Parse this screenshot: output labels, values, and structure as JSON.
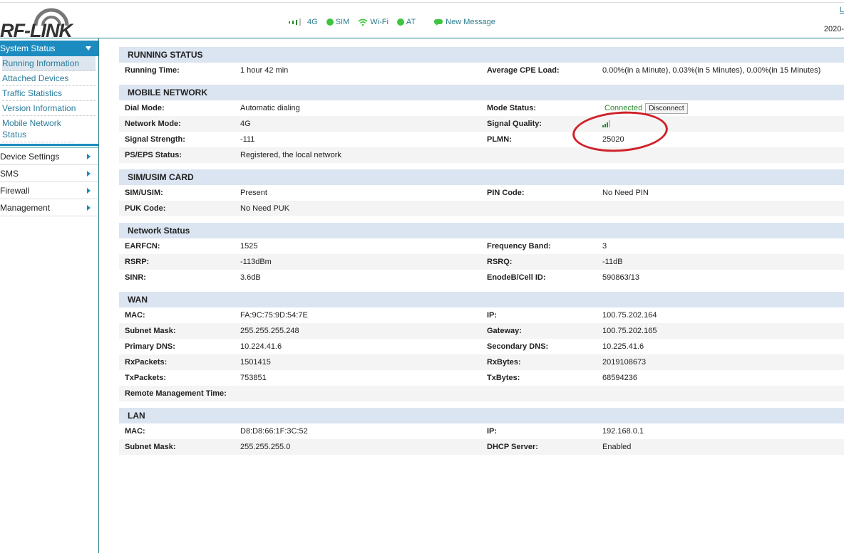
{
  "header": {
    "logo": "RF-LINK",
    "status": [
      {
        "icon": "signal-icon",
        "label": "4G"
      },
      {
        "icon": "sim-dot-icon",
        "label": "SIM"
      },
      {
        "icon": "wifi-icon",
        "label": "Wi-Fi"
      },
      {
        "icon": "at-dot-icon",
        "label": "AT"
      },
      {
        "icon": "message-icon",
        "label": "New Message"
      }
    ],
    "logout": "L",
    "date": "2020-"
  },
  "sidebar": {
    "head": "System Status",
    "sub": [
      "Running Information",
      "Attached Devices",
      "Traffic Statistics",
      "Version Information",
      "Mobile Network Status"
    ],
    "menu": [
      "Device Settings",
      "SMS",
      "Firewall",
      "Management"
    ]
  },
  "sections": [
    {
      "title": "RUNNING STATUS",
      "rows": [
        [
          "Running Time:",
          "1 hour 42 min",
          "Average CPE Load:",
          "0.00%(in a Minute), 0.03%(in 5 Minutes), 0.00%(in 15 Minutes)"
        ]
      ]
    },
    {
      "title": "MOBILE NETWORK",
      "rows": [
        [
          "Dial Mode:",
          "Automatic dialing",
          "Mode Status:",
          "Connected"
        ],
        [
          "Network Mode:",
          "4G",
          "Signal Quality:",
          ""
        ],
        [
          "Signal Strength:",
          "-111",
          "PLMN:",
          "25020"
        ],
        [
          "PS/EPS Status:",
          "Registered, the local network",
          "",
          ""
        ]
      ]
    },
    {
      "title": "SIM/USIM CARD",
      "rows": [
        [
          "SIM/USIM:",
          "Present",
          "PIN Code:",
          "No Need PIN"
        ],
        [
          "PUK Code:",
          "No Need PUK",
          "",
          ""
        ]
      ]
    },
    {
      "title": "Network Status",
      "rows": [
        [
          "EARFCN:",
          "1525",
          "Frequency Band:",
          "3"
        ],
        [
          "RSRP:",
          "-113dBm",
          "RSRQ:",
          "-11dB"
        ],
        [
          "SINR:",
          "3.6dB",
          "EnodeB/Cell ID:",
          "590863/13"
        ]
      ]
    },
    {
      "title": "WAN",
      "rows": [
        [
          "MAC:",
          "FA:9C:75:9D:54:7E",
          "IP:",
          "100.75.202.164"
        ],
        [
          "Subnet Mask:",
          "255.255.255.248",
          "Gateway:",
          "100.75.202.165"
        ],
        [
          "Primary DNS:",
          "10.224.41.6",
          "Secondary DNS:",
          "10.225.41.6"
        ],
        [
          "RxPackets:",
          "1501415",
          "RxBytes:",
          "2019108673"
        ],
        [
          "TxPackets:",
          "753851",
          "TxBytes:",
          "68594236"
        ],
        [
          "Remote Management Time:",
          "",
          "",
          ""
        ]
      ]
    },
    {
      "title": "LAN",
      "rows": [
        [
          "MAC:",
          "D8:D8:66:1F:3C:52",
          "IP:",
          "192.168.0.1"
        ],
        [
          "Subnet Mask:",
          "255.255.255.0",
          "DHCP Server:",
          "Enabled"
        ]
      ]
    }
  ],
  "disconnect_label": "Disconnect",
  "signal_quality_bars": 3,
  "colors": {
    "accent": "#1c8cc0",
    "connected": "#2e8b2e",
    "annotation": "#d0202a"
  }
}
